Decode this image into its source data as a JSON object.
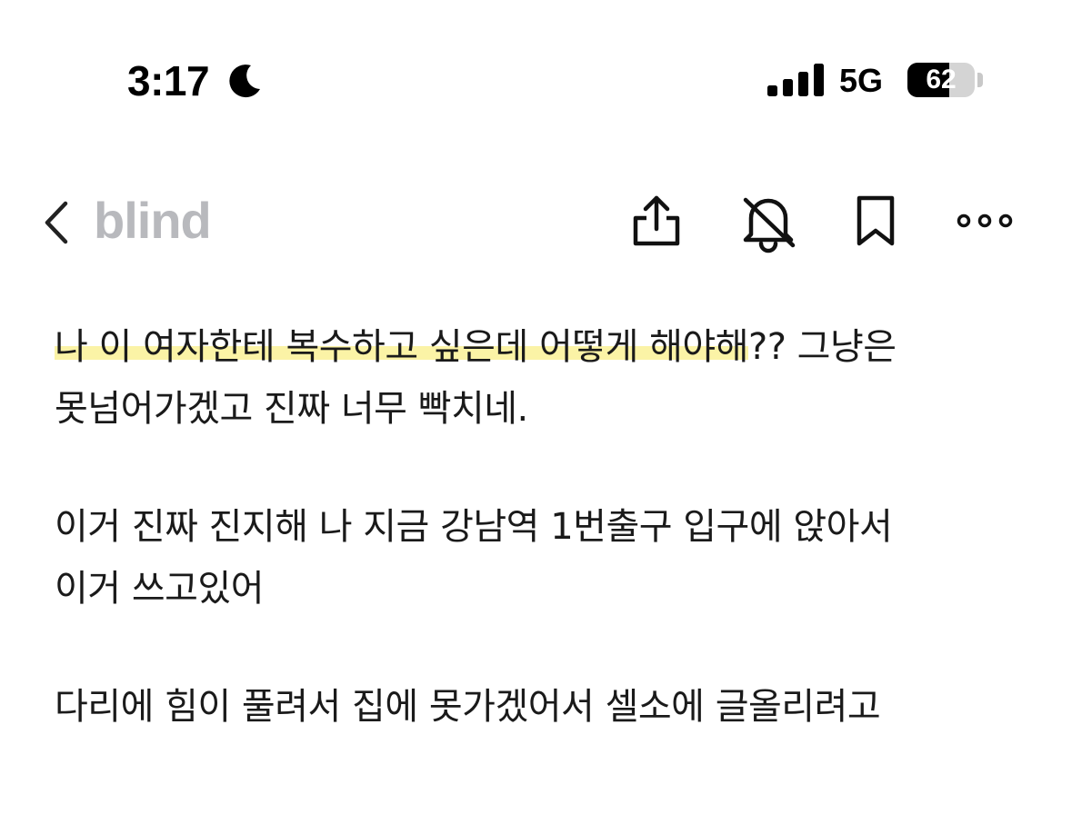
{
  "status_bar": {
    "time": "3:17",
    "network": "5G",
    "battery": "62",
    "battery_level": 0.62,
    "icons": [
      "moon-icon",
      "signal-icon",
      "battery-icon"
    ]
  },
  "nav": {
    "back_icon": "chevron-left-icon",
    "brand": "blind",
    "actions": [
      "share-icon",
      "bell-off-icon",
      "bookmark-icon",
      "more-horizontal-icon"
    ]
  },
  "post": {
    "p1_line1_highlight": "나 이 여자한테 복수하고 싶은데 어떻게 해야해",
    "p1_line1_rest": "?? 그냥은",
    "p1_line2": "못넘어가겠고 진짜 너무 빡치네.",
    "p2_line1": "이거 진짜 진지해 나 지금 강남역 1번출구 입구에 앉아서",
    "p2_line2": "이거 쓰고있어",
    "p3_line1": "다리에 힘이 풀려서 집에 못가겠어서 셀소에 글올리려고"
  },
  "colors": {
    "brand_gray": "#b8b9bd",
    "highlight_yellow": "#fbf3a6",
    "text": "#1a1a1a"
  }
}
